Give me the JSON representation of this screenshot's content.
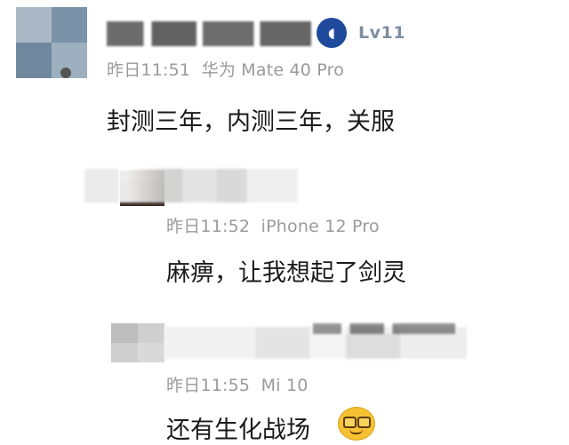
{
  "comments": [
    {
      "level": "Lv11",
      "time": "昨日11:51",
      "device": "华为 Mate 40 Pro",
      "text": "封测三年，内测三年，关服"
    },
    {
      "time": "昨日11:52",
      "device": "iPhone 12 Pro",
      "text": "麻痹，让我想起了剑灵"
    },
    {
      "time": "昨日11:55",
      "device": "Mi 10",
      "text": "还有生化战场"
    }
  ],
  "icons": {
    "level_badge": "playstation-badge-icon",
    "emoji": "grinning-emoji-icon"
  },
  "colors": {
    "meta_text": "#9a9a9a",
    "content_text": "#1a1a1a",
    "level_text": "#7d8fa0",
    "badge_bg": "#1f4a9c"
  }
}
